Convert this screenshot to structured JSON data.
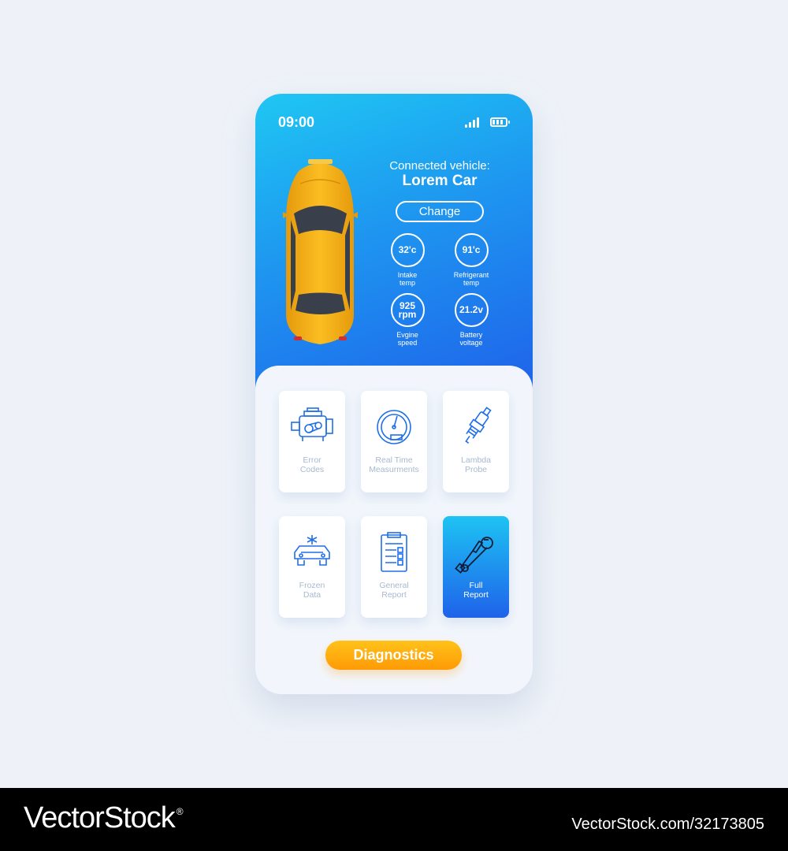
{
  "status_bar": {
    "time": "09:00"
  },
  "vehicle": {
    "connected_label": "Connected vehicle:",
    "name": "Lorem Car",
    "change_label": "Change"
  },
  "metrics": [
    {
      "value": "32'c",
      "label_line1": "Intake",
      "label_line2": "temp"
    },
    {
      "value": "91'c",
      "label_line1": "Refrigerant",
      "label_line2": "temp"
    },
    {
      "value_line1": "925",
      "value_line2": "rpm",
      "label_line1": "Evgine",
      "label_line2": "speed"
    },
    {
      "value": "21.2v",
      "label_line1": "Battery",
      "label_line2": "voltage"
    }
  ],
  "tiles": [
    {
      "line1": "Error",
      "line2": "Codes",
      "icon": "engine-icon"
    },
    {
      "line1": "Real Time",
      "line2": "Measurments",
      "icon": "speedometer-icon"
    },
    {
      "line1": "Lambda",
      "line2": "Probe",
      "icon": "spark-plug-icon"
    },
    {
      "line1": "Frozen",
      "line2": "Data",
      "icon": "frozen-car-icon"
    },
    {
      "line1": "General",
      "line2": "Report",
      "icon": "clipboard-icon"
    },
    {
      "line1": "Full",
      "line2": "Report",
      "icon": "tools-icon",
      "active": true
    }
  ],
  "diagnostics_label": "Diagnostics",
  "colors": {
    "gradient_top": "#1fc7f3",
    "gradient_bottom": "#1f62ea",
    "accent_orange": "#ff9a05",
    "car_yellow": "#f5b21a",
    "tile_text": "#a8b9cf"
  },
  "watermark": {
    "brand": "VectorStock",
    "reg": "®",
    "url": "VectorStock.com/32173805"
  }
}
